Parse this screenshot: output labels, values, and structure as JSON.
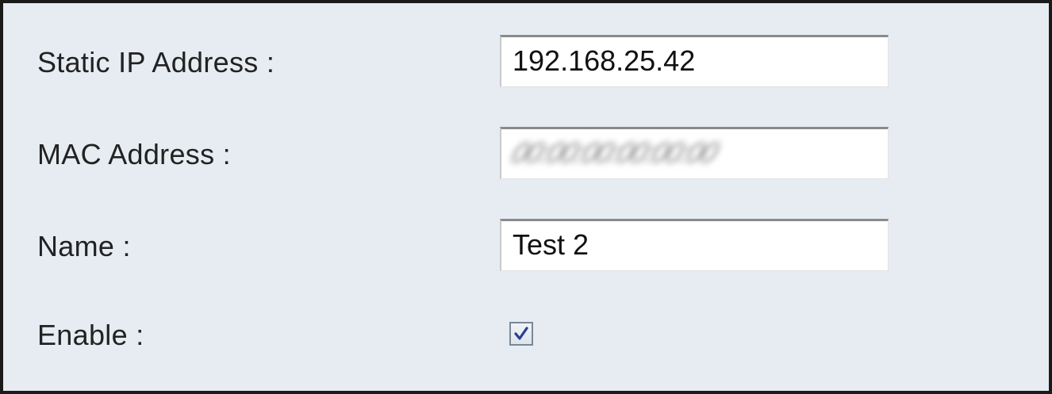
{
  "form": {
    "static_ip": {
      "label": "Static IP Address :",
      "value": "192.168.25.42"
    },
    "mac_address": {
      "label": "MAC Address :",
      "value": "00:00:00:00:00:00",
      "value_obscured": true
    },
    "name": {
      "label": "Name :",
      "value": "Test 2"
    },
    "enable": {
      "label": "Enable :",
      "checked": true
    }
  },
  "colors": {
    "panel_background": "#e6ecf2",
    "panel_border": "#1a1a1a",
    "field_background": "#ffffff",
    "check_mark": "#2b3f8f"
  },
  "icons": {
    "enable_checkbox": "checkmark-icon"
  }
}
